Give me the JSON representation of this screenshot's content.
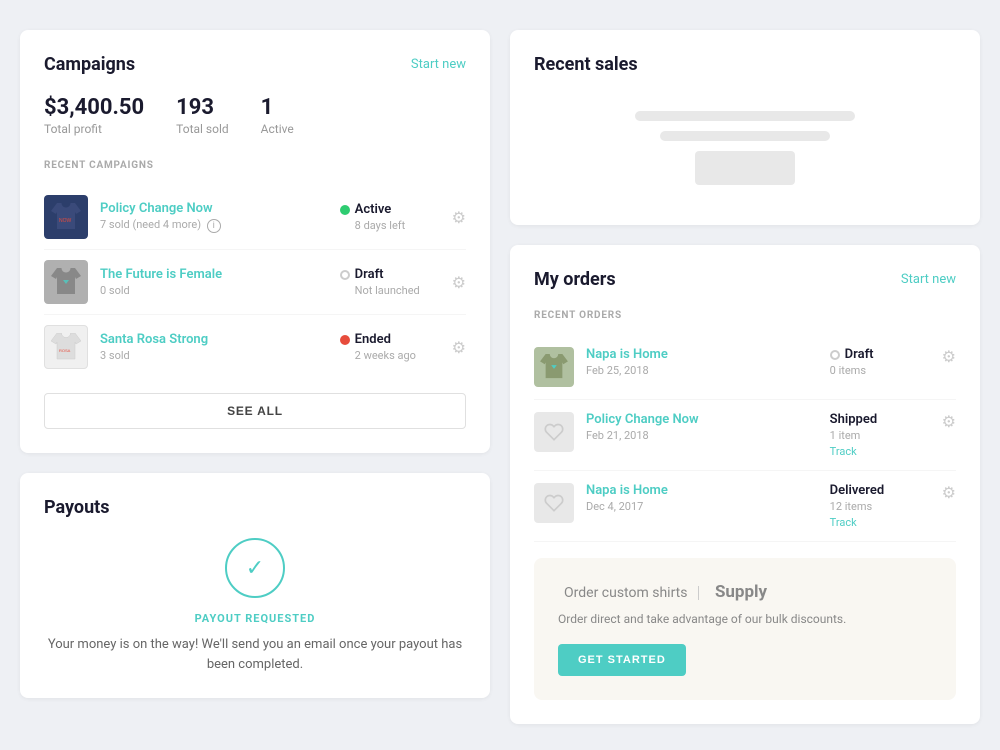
{
  "campaigns": {
    "title": "Campaigns",
    "start_new_label": "Start new",
    "stats": {
      "profit": {
        "value": "$3,400.50",
        "label": "Total profit"
      },
      "sold": {
        "value": "193",
        "label": "Total sold"
      },
      "active": {
        "value": "1",
        "label": "Active"
      }
    },
    "section_label": "RECENT CAMPAIGNS",
    "items": [
      {
        "name": "Policy Change Now",
        "sub": "7 sold (need 4 more)",
        "status": "Active",
        "status_sub": "8 days left",
        "status_type": "active",
        "thumb_type": "dark"
      },
      {
        "name": "The Future is Female",
        "sub": "0 sold",
        "status": "Draft",
        "status_sub": "Not launched",
        "status_type": "draft",
        "thumb_type": "gray"
      },
      {
        "name": "Santa Rosa Strong",
        "sub": "3 sold",
        "status": "Ended",
        "status_sub": "2 weeks ago",
        "status_type": "ended",
        "thumb_type": "white"
      }
    ],
    "see_all_label": "SEE ALL"
  },
  "recent_sales": {
    "title": "Recent sales"
  },
  "my_orders": {
    "title": "My orders",
    "start_new_label": "Start new",
    "section_label": "RECENT ORDERS",
    "items": [
      {
        "name": "Napa is Home",
        "date": "Feb 25, 2018",
        "status": "Draft",
        "status_sub": "0 items",
        "status_type": "draft",
        "thumb_type": "green",
        "has_track": false
      },
      {
        "name": "Policy Change Now",
        "date": "Feb 21, 2018",
        "status": "Shipped",
        "status_sub": "1 item",
        "status_type": "shipped",
        "thumb_type": "icon",
        "has_track": true,
        "track_label": "Track"
      },
      {
        "name": "Napa is Home",
        "date": "Dec 4, 2017",
        "status": "Delivered",
        "status_sub": "12 items",
        "status_type": "delivered",
        "thumb_type": "icon",
        "has_track": true,
        "track_label": "Track"
      }
    ]
  },
  "payouts": {
    "title": "Payouts",
    "requested_label": "PAYOUT REQUESTED",
    "description": "Your money is on the way! We'll send you an email once your payout has been completed."
  },
  "supply": {
    "title": "Order custom shirts",
    "supply_label": "Supply",
    "description": "Order direct and take advantage of our bulk discounts.",
    "cta_label": "GET STARTED"
  }
}
